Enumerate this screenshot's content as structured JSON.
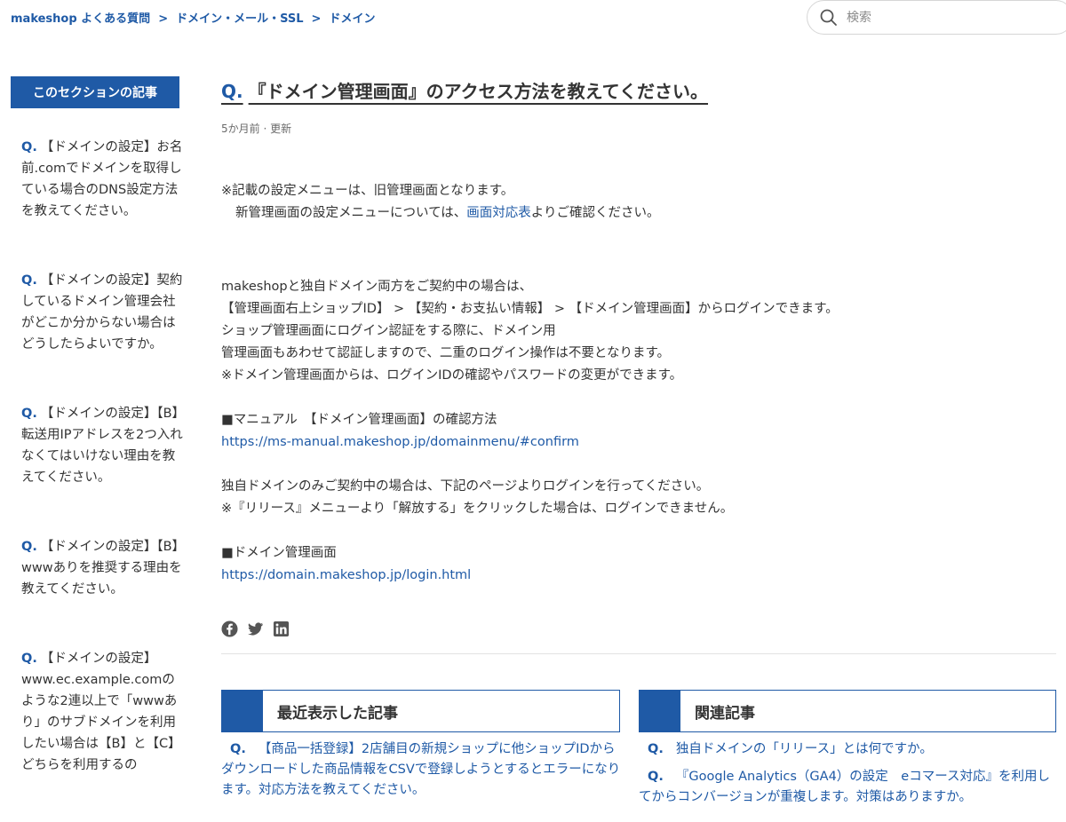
{
  "breadcrumb": {
    "home": "makeshop よくある質問",
    "level1": "ドメイン・メール・SSL",
    "level2": "ドメイン",
    "separator": ">"
  },
  "search": {
    "placeholder": "検索"
  },
  "sidebar": {
    "heading": "このセクションの記事",
    "q_prefix": "Q.",
    "items": [
      {
        "label": "【ドメインの設定】お名前.comでドメインを取得している場合のDNS設定方法を教えてください。"
      },
      {
        "label": "【ドメインの設定】契約しているドメイン管理会社がどこか分からない場合はどうしたらよいですか。"
      },
      {
        "label": "【ドメインの設定】【B】転送用IPアドレスを2つ入れなくてはいけない理由を教えてください。"
      },
      {
        "label": "【ドメインの設定】【B】wwwありを推奨する理由を教えてください。"
      },
      {
        "label": "【ドメインの設定】www.ec.example.comのような2連以上で「wwwあり」のサブドメインを利用したい場合は【B】と【C】どちらを利用するの"
      }
    ]
  },
  "article": {
    "q_prefix": "Q.",
    "title": "『ドメイン管理画面』のアクセス方法を教えてください。",
    "meta": "5か月前 ·  更新",
    "note_line1": "※記載の設定メニューは、旧管理画面となります。",
    "note_line2_pre": "新管理画面の設定メニューについては、",
    "note_line2_link": "画面対応表",
    "note_line2_post": "よりご確認ください。",
    "para2": "makeshopと独自ドメイン両方をご契約中の場合は、\n【管理画面右上ショップID】 > 【契約・お支払い情報】 > 【ドメイン管理画面】からログインできます。\nショップ管理画面にログイン認証をする際に、ドメイン用\n管理画面もあわせて認証しますので、二重のログイン操作は不要となります。\n※ドメイン管理画面からは、ログインIDの確認やパスワードの変更ができます。",
    "manual1_label": "■マニュアル　【ドメイン管理画面】の確認方法",
    "manual1_link": "https://ms-manual.makeshop.jp/domainmenu/#confirm",
    "para3": "独自ドメインのみご契約中の場合は、下記のページよりログインを行ってください。\n※『リリース』メニューより「解放する」をクリックした場合は、ログインできません。",
    "manual2_label": "■ドメイン管理画面",
    "manual2_link": "https://domain.makeshop.jp/login.html"
  },
  "recent": {
    "heading": "最近表示した記事",
    "q_prefix": "Q.",
    "items": [
      {
        "label": "【商品一括登録】2店舗目の新規ショップに他ショップIDからダウンロードした商品情報をCSVで登録しようとするとエラーになります。対応方法を教えてください。"
      }
    ]
  },
  "related": {
    "heading": "関連記事",
    "q_prefix": "Q.",
    "items": [
      {
        "label": "独自ドメインの「リリース」とは何ですか。"
      },
      {
        "label": "『Google Analytics（GA4）の設定　eコマース対応』を利用してからコンバージョンが重複します。対策はありますか。"
      }
    ]
  },
  "colors": {
    "accent": "#1f5aa6",
    "text": "#333333",
    "meta": "#6a6a6a"
  }
}
